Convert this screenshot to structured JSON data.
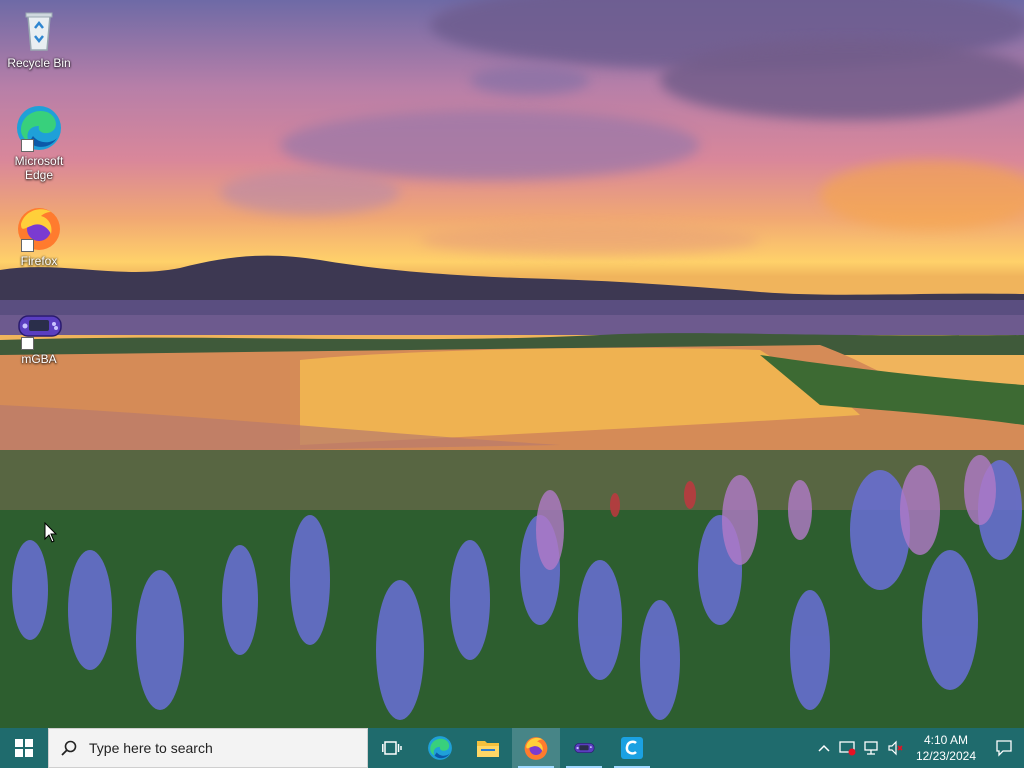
{
  "desktop": {
    "icons": [
      {
        "label": "Recycle Bin",
        "icon": "recycle-bin-icon"
      },
      {
        "label": "Microsoft Edge",
        "icon": "edge-icon"
      },
      {
        "label": "Firefox",
        "icon": "firefox-icon"
      },
      {
        "label": "mGBA",
        "icon": "mgba-icon"
      }
    ]
  },
  "taskbar": {
    "start_icon": "windows-logo-icon",
    "search_placeholder": "Type here to search",
    "apps": [
      {
        "name": "Task View",
        "icon": "task-view-icon",
        "state": "idle"
      },
      {
        "name": "Microsoft Edge",
        "icon": "edge-icon",
        "state": "idle"
      },
      {
        "name": "File Explorer",
        "icon": "folder-icon",
        "state": "idle"
      },
      {
        "name": "Firefox",
        "icon": "firefox-icon",
        "state": "active"
      },
      {
        "name": "mGBA",
        "icon": "mgba-icon",
        "state": "idle"
      },
      {
        "name": "App",
        "icon": "c-app-icon",
        "state": "idle"
      }
    ],
    "tray": {
      "time": "4:10 AM",
      "date": "12/23/2024"
    }
  },
  "colors": {
    "taskbar": "#1f6b6d",
    "search_bg": "#f3f3f3",
    "accent": "#9fd8ff"
  }
}
